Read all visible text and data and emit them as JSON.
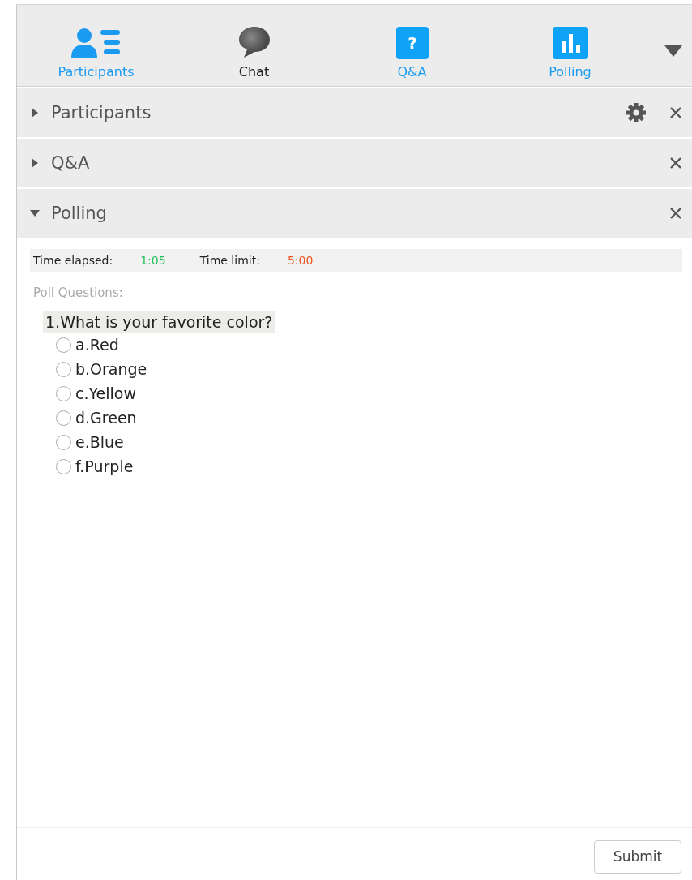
{
  "toolbar": {
    "tabs": [
      {
        "label": "Participants",
        "kind": "participants",
        "open": true
      },
      {
        "label": "Chat",
        "kind": "chat",
        "open": false
      },
      {
        "label": "Q&A",
        "kind": "qa",
        "open": true,
        "glyph": "?"
      },
      {
        "label": "Polling",
        "kind": "polling",
        "open": true
      }
    ]
  },
  "sections": [
    {
      "title": "Participants",
      "expanded": false,
      "settings": true
    },
    {
      "title": "Q&A",
      "expanded": false,
      "settings": false
    },
    {
      "title": "Polling",
      "expanded": true,
      "settings": false
    }
  ],
  "poll": {
    "elapsed_label": "Time elapsed:",
    "elapsed": "1:05",
    "limit_label": "Time limit:",
    "limit": "5:00",
    "questions_label": "Poll Questions:",
    "question": "1.What is your favorite color?",
    "options": [
      {
        "label": "a.Red",
        "selected": false
      },
      {
        "label": "b.Orange",
        "selected": false
      },
      {
        "label": "c.Yellow",
        "selected": false
      },
      {
        "label": "d.Green",
        "selected": false
      },
      {
        "label": "e.Blue",
        "selected": false
      },
      {
        "label": "f.Purple",
        "selected": false
      }
    ],
    "submit": "Submit"
  }
}
